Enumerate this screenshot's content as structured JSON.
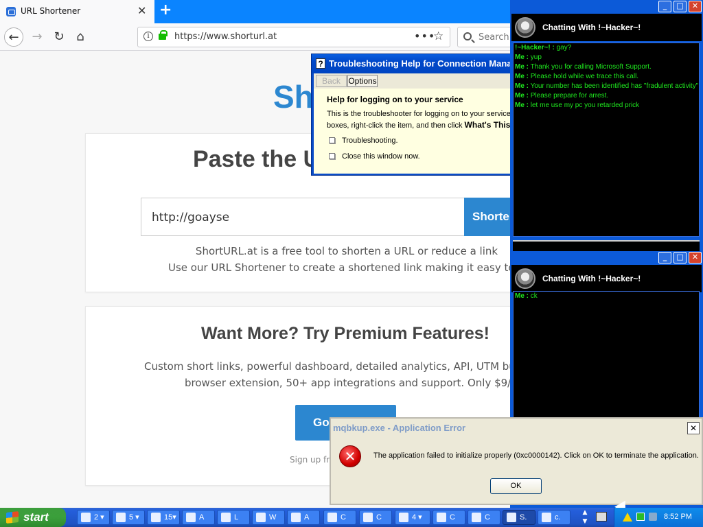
{
  "browser": {
    "tab_title": "URL Shortener",
    "tab_close": "✕",
    "new_tab": "+",
    "url": "https://www.shorturl.at",
    "url_menu": "•••",
    "search_placeholder": "Search"
  },
  "page": {
    "logo": "Sho",
    "paste_title": "Paste the U",
    "input_value": "http://goayse",
    "shorten_label": "Shorte",
    "desc_line1": "ShortURL.at is a free tool to shorten a URL or reduce a link",
    "desc_line2": "Use our URL Shortener to create a shortened link making it easy to rememb",
    "premium_title": "Want More? Try Premium Features!",
    "premium_line1": "Custom short links, powerful dashboard, detailed analytics, API, UTM builder, QR",
    "premium_line2": "browser extension, 50+ app integrations and support. Only $9/month.",
    "go_label": "Go",
    "signup_text": "Sign up fre"
  },
  "help_window": {
    "title": "Troubleshooting Help for Connection Mana",
    "qicon": "?",
    "back": "Back",
    "options": "Options",
    "heading": "Help for logging on to your service",
    "text1": "This is the troubleshooter for logging on to your service. F",
    "text2_pre": "boxes, right-click the item, and then click ",
    "text2_bold": "What's This?",
    "option1": "Troubleshooting.",
    "option2": "Close this window now."
  },
  "chat1": {
    "title": "Chatting With !~Hacker~!",
    "messages": [
      {
        "sender": "!~Hacker~! :",
        "text": " gay?"
      },
      {
        "sender": "Me :",
        "text": " yup"
      },
      {
        "sender": "Me :",
        "text": " Thank you for calling Microsoft Support."
      },
      {
        "sender": "Me :",
        "text": " Please hold while we trace this call."
      },
      {
        "sender": "Me :",
        "text": " Your number has been identified has \"fradulent activity\""
      },
      {
        "sender": "Me :",
        "text": " Please prepare for arrest."
      },
      {
        "sender": "Me :",
        "text": " let me use my pc you retarded prick"
      }
    ]
  },
  "chat2": {
    "title": "Chatting With !~Hacker~!",
    "messages": [
      {
        "sender": "Me :",
        "text": " ck"
      }
    ]
  },
  "error_dialog": {
    "title": "mqbkup.exe - Application Error",
    "close": "✕",
    "icon": "✕",
    "message": "The application failed to initialize properly (0xc0000142). Click on OK to terminate the application.",
    "ok": "OK"
  },
  "taskbar": {
    "start": "start",
    "buttons": [
      "2",
      "5",
      "15",
      "A",
      "L",
      "W",
      "A",
      "C",
      "C",
      "4",
      "C",
      "C",
      "S.",
      "c."
    ],
    "clock": "8:52 PM"
  }
}
